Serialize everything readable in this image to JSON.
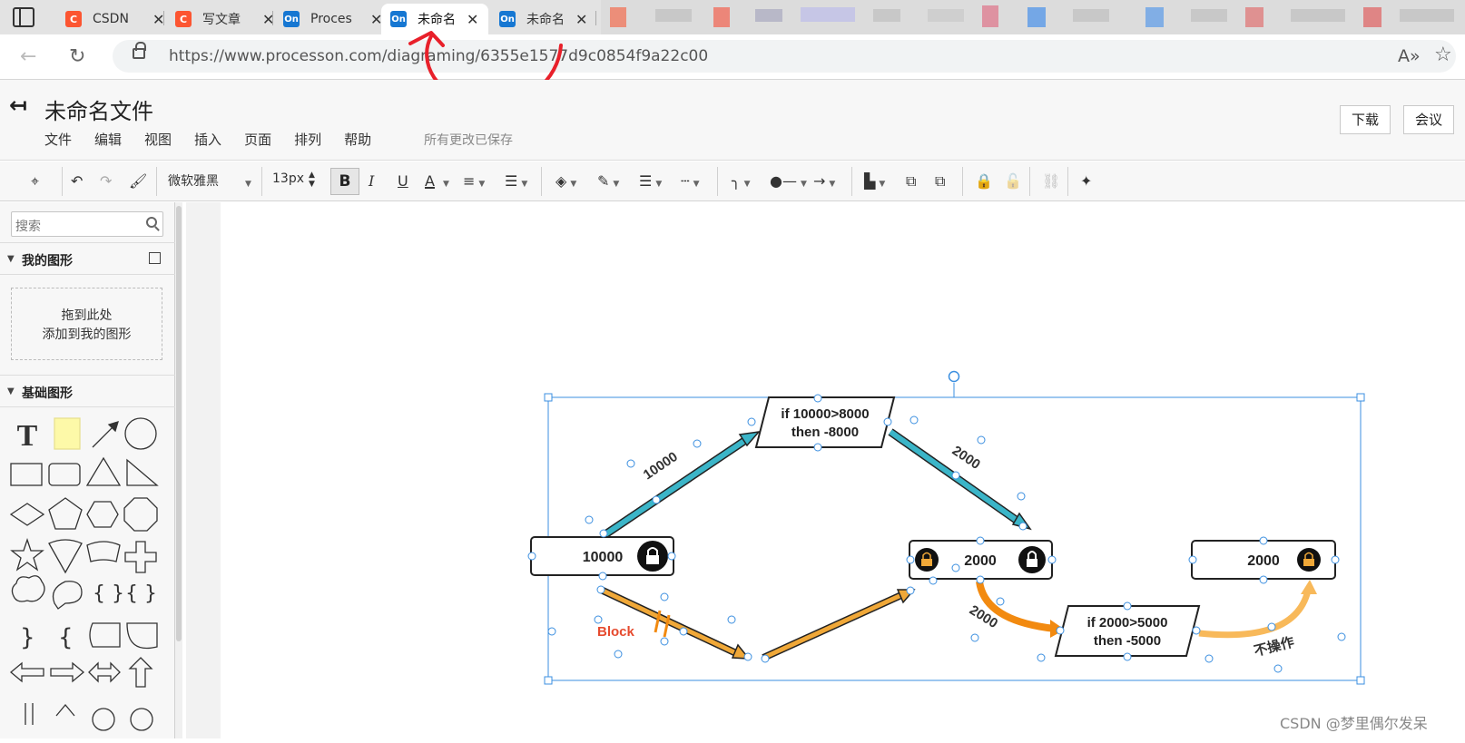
{
  "browser": {
    "tabs": [
      {
        "favicon": "C",
        "label": "CSDN"
      },
      {
        "favicon": "C",
        "label": "写文章"
      },
      {
        "favicon": "On",
        "label": "Proces"
      },
      {
        "favicon": "On",
        "label": "未命名"
      },
      {
        "favicon": "On",
        "label": "未命名"
      }
    ],
    "url": "https://www.processon.com/diagraming/6355e1577d9c0854f9a22c00"
  },
  "app": {
    "title": "未命名文件",
    "menu": [
      "文件",
      "编辑",
      "视图",
      "插入",
      "页面",
      "排列",
      "帮助"
    ],
    "save_status": "所有更改已保存",
    "download_label": "下载",
    "meeting_label": "会议"
  },
  "toolbar": {
    "font_family": "微软雅黑",
    "font_size": "13px",
    "bold": "B",
    "italic": "I",
    "underline": "U",
    "font_color": "A"
  },
  "sidebar": {
    "search_placeholder": "搜索",
    "my_shapes": "我的图形",
    "drop_line1": "拖到此处",
    "drop_line2": "添加到我的图形",
    "basic_shapes": "基础图形",
    "text_tool": "T"
  },
  "diagram": {
    "box1": "10000",
    "box2": "2000",
    "box3": "2000",
    "para1_line1": "if 10000>8000",
    "para1_line2": "then -8000",
    "para2_line1": "if 2000>5000",
    "para2_line2": "then -5000",
    "label_10000": "10000",
    "label_2000_a": "2000",
    "label_2000_b": "2000",
    "label_block": "Block",
    "label_noop": "不操作"
  },
  "watermark": "CSDN @梦里偶尔发呆",
  "colors": {
    "teal": "#3bb5c8",
    "orange": "#f0a838",
    "orange_dark": "#f28a10",
    "block_red": "#e64a2e",
    "selection": "#3b8fe0",
    "annotation_red": "#e8202a"
  }
}
